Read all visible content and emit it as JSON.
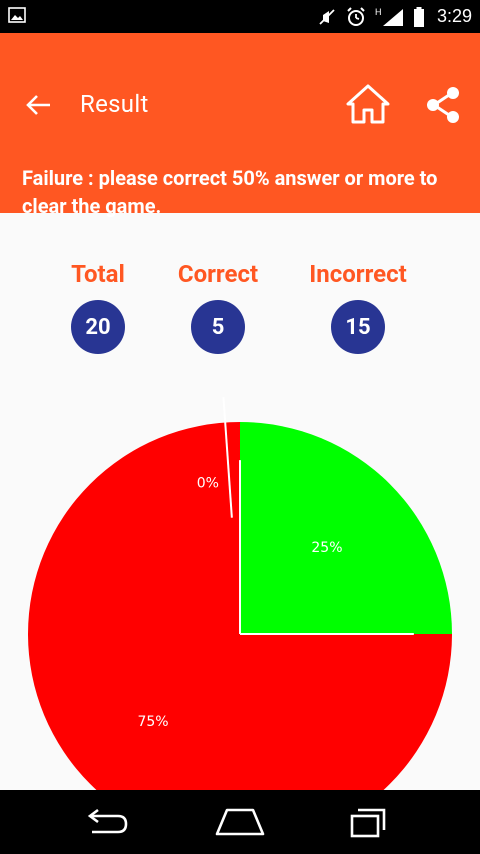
{
  "status_bar": {
    "time": "3:29",
    "icons": [
      "gallery-icon",
      "mute-icon",
      "alarm-icon",
      "signal-icon",
      "battery-icon"
    ]
  },
  "app_bar": {
    "title": "Result",
    "message": "Failure : please correct 50% answer or more to clear the game.",
    "icons": [
      "back-arrow-icon",
      "home-icon",
      "share-icon"
    ]
  },
  "stats": {
    "total_label": "Total",
    "total_value": "20",
    "correct_label": "Correct",
    "correct_value": "5",
    "incorrect_label": "Incorrect",
    "incorrect_value": "15"
  },
  "chart_data": {
    "type": "pie",
    "slices": [
      {
        "label": "25%",
        "value": 25,
        "color": "#00ff00"
      },
      {
        "label": "75%",
        "value": 75,
        "color": "#ff0000"
      },
      {
        "label": "0%",
        "value": 0,
        "color": "#ff0000"
      }
    ]
  },
  "colors": {
    "primary": "#ff5722",
    "badge": "#283593",
    "correct": "#00ff00",
    "incorrect": "#ff0000"
  },
  "nav_bar": {
    "icons": [
      "nav-back-icon",
      "nav-home-icon",
      "nav-recents-icon"
    ]
  }
}
